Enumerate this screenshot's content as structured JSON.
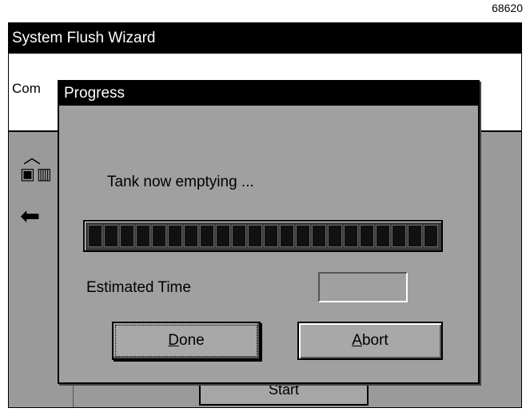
{
  "figure_ref": "68620",
  "window": {
    "title": "System Flush Wizard",
    "body_text": "Com"
  },
  "side_icons": [
    "up-arrow-icon",
    "tools-icon",
    "back-arrow-icon"
  ],
  "start_button": {
    "label": "Start"
  },
  "dialog": {
    "title": "Progress",
    "message": "Tank now emptying ...",
    "progress": {
      "segments_total": 22,
      "segments_filled": 22
    },
    "estimated_time_label": "Estimated Time",
    "estimated_time_value": "",
    "done_mnemonic": "D",
    "done_rest": "one",
    "abort_mnemonic": "A",
    "abort_rest": "bort"
  }
}
